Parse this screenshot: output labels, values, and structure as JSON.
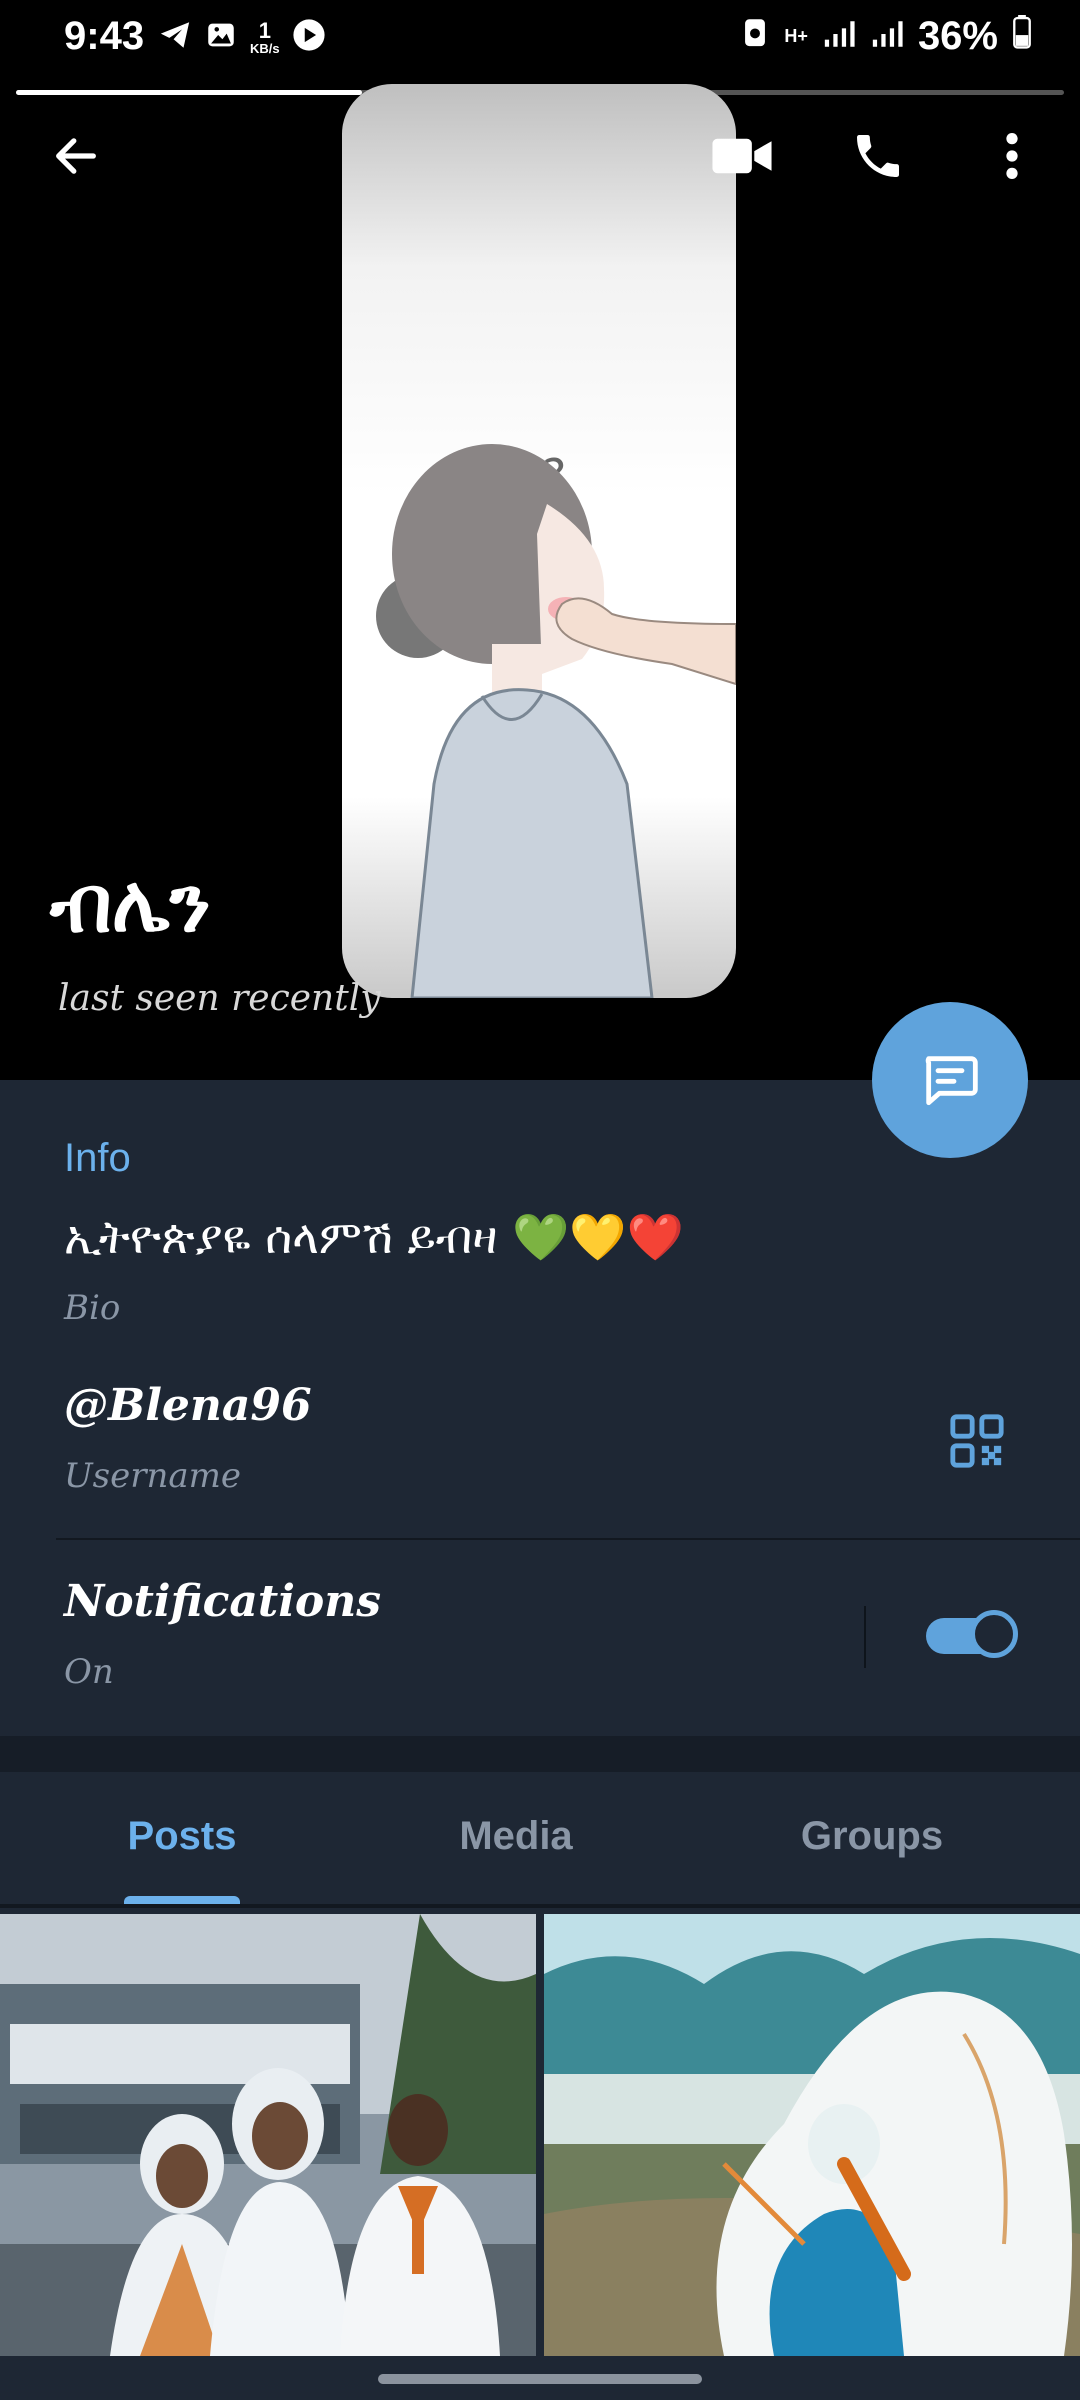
{
  "status_bar": {
    "time": "9:43",
    "net_speed_value": "1",
    "net_speed_unit": "KB/s",
    "network_type": "H+",
    "battery": "36%"
  },
  "story": {
    "progress_fraction": 0.33
  },
  "profile": {
    "name": "ብሌን",
    "last_seen": "last seen recently"
  },
  "info": {
    "section_title": "Info",
    "bio_value": "ኢትዮጵያዬ ሰላምሽ ይብዛ 💚💛❤️",
    "bio_label": "Bio",
    "username_value": "@Blena96",
    "username_label": "Username",
    "notifications_value": "Notifications",
    "notifications_label": "On",
    "notifications_enabled": true
  },
  "tabs": [
    {
      "label": "Posts",
      "active": true
    },
    {
      "label": "Media",
      "active": false
    },
    {
      "label": "Groups",
      "active": false
    }
  ],
  "colors": {
    "accent": "#6cb1ec",
    "fab": "#5fa3dc",
    "panel": "#1e2734",
    "hero": "#000000"
  },
  "icons": {
    "back": "arrow-left-icon",
    "video_call": "video-camera-icon",
    "call": "phone-icon",
    "more": "more-vertical-icon",
    "message": "message-icon",
    "qr": "qr-code-icon"
  }
}
